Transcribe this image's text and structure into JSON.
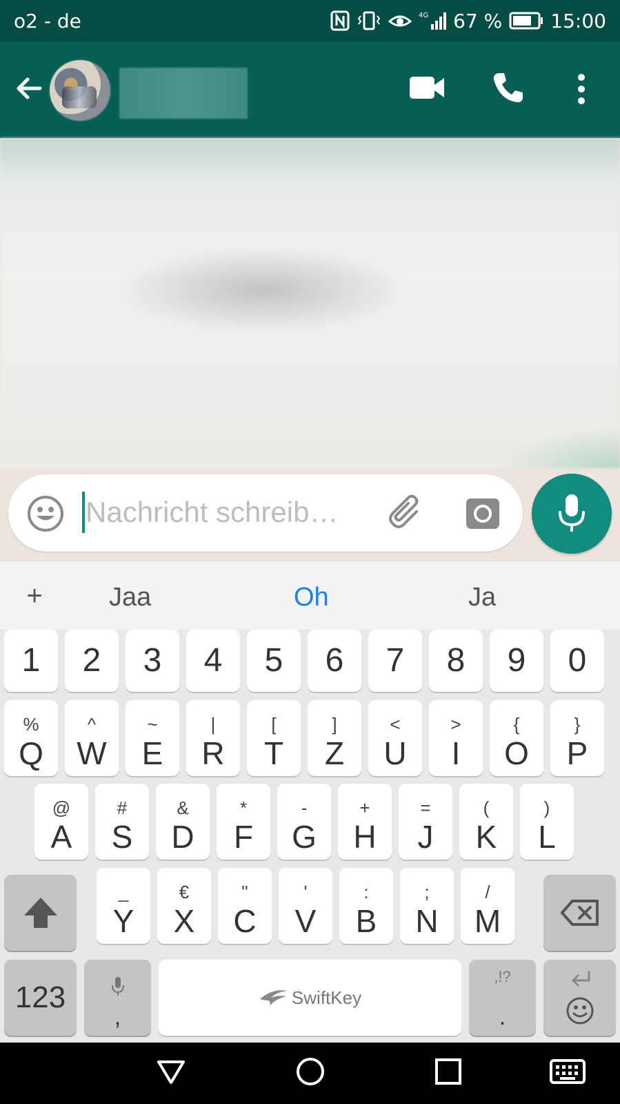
{
  "status_bar": {
    "carrier": "o2 - de",
    "battery": "67 %",
    "time": "15:00",
    "network": "4G"
  },
  "header": {
    "icons": [
      "back-arrow-icon",
      "video-call-icon",
      "phone-icon",
      "more-vert-icon"
    ]
  },
  "composer": {
    "placeholder": "Nachricht schreib…",
    "value": "",
    "icons": [
      "emoji-icon",
      "paperclip-icon",
      "camera-icon",
      "microphone-icon"
    ]
  },
  "suggestions": {
    "plus": "+",
    "items": [
      "Jaa",
      "Oh",
      "Ja"
    ],
    "active_index": 1
  },
  "keyboard": {
    "numbers": [
      "1",
      "2",
      "3",
      "4",
      "5",
      "6",
      "7",
      "8",
      "9",
      "0"
    ],
    "row1": [
      {
        "main": "Q",
        "sub": "%"
      },
      {
        "main": "W",
        "sub": "^"
      },
      {
        "main": "E",
        "sub": "~"
      },
      {
        "main": "R",
        "sub": "|"
      },
      {
        "main": "T",
        "sub": "["
      },
      {
        "main": "Z",
        "sub": "]"
      },
      {
        "main": "U",
        "sub": "<"
      },
      {
        "main": "I",
        "sub": ">"
      },
      {
        "main": "O",
        "sub": "{"
      },
      {
        "main": "P",
        "sub": "}"
      }
    ],
    "row2": [
      {
        "main": "A",
        "sub": "@"
      },
      {
        "main": "S",
        "sub": "#"
      },
      {
        "main": "D",
        "sub": "&"
      },
      {
        "main": "F",
        "sub": "*"
      },
      {
        "main": "G",
        "sub": "-"
      },
      {
        "main": "H",
        "sub": "+"
      },
      {
        "main": "J",
        "sub": "="
      },
      {
        "main": "K",
        "sub": "("
      },
      {
        "main": "L",
        "sub": ")"
      }
    ],
    "row3": [
      {
        "main": "Y",
        "sub": "_"
      },
      {
        "main": "X",
        "sub": "€"
      },
      {
        "main": "C",
        "sub": "\""
      },
      {
        "main": "V",
        "sub": "'"
      },
      {
        "main": "B",
        "sub": ":"
      },
      {
        "main": "N",
        "sub": ";"
      },
      {
        "main": "M",
        "sub": "/"
      }
    ],
    "symbols_key": "123",
    "comma_key": ",",
    "space_brand": "SwiftKey",
    "period_key": ".",
    "period_sub": ",!?"
  },
  "colors": {
    "status_bar": "#054d44",
    "header": "#075e54",
    "accent": "#128c7e",
    "suggestion_active": "#1a7ff0"
  }
}
